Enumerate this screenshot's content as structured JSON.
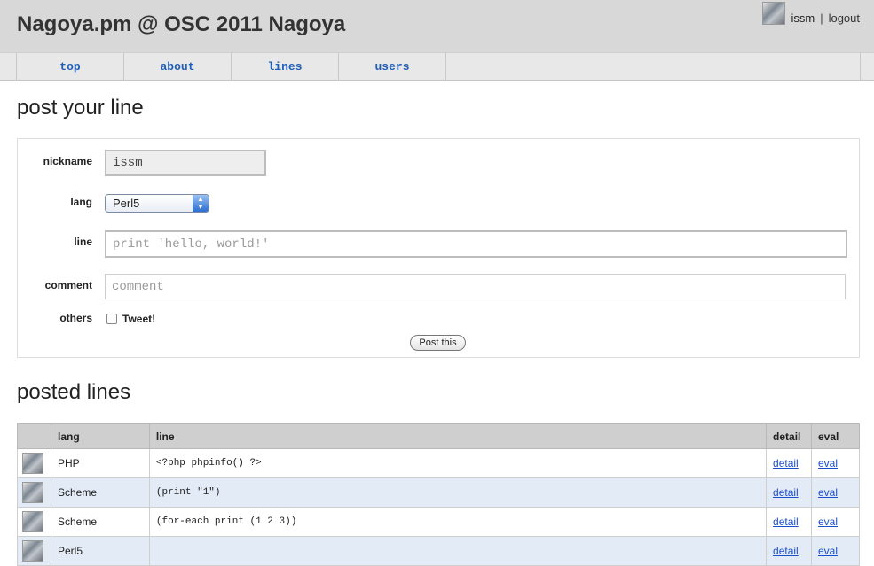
{
  "header": {
    "title": "Nagoya.pm @ OSC 2011 Nagoya",
    "username": "issm",
    "separator": "|",
    "logout": "logout"
  },
  "nav": {
    "tabs": [
      {
        "label": "top"
      },
      {
        "label": "about"
      },
      {
        "label": "lines"
      },
      {
        "label": "users"
      }
    ]
  },
  "form": {
    "heading": "post your line",
    "nickname_label": "nickname",
    "nickname_value": "issm",
    "lang_label": "lang",
    "lang_value": "Perl5",
    "line_label": "line",
    "line_placeholder": "print 'hello, world!'",
    "comment_label": "comment",
    "comment_placeholder": "comment",
    "others_label": "others",
    "tweet_label": "Tweet!",
    "submit_label": "Post this"
  },
  "posted": {
    "heading": "posted lines",
    "columns": [
      "",
      "lang",
      "line",
      "detail",
      "eval"
    ],
    "rows": [
      {
        "lang": "PHP",
        "line": "<?php phpinfo() ?>",
        "detail": "detail",
        "eval": "eval"
      },
      {
        "lang": "Scheme",
        "line": "(print \"1\")",
        "detail": "detail",
        "eval": "eval"
      },
      {
        "lang": "Scheme",
        "line": "(for-each print (1 2 3))",
        "detail": "detail",
        "eval": "eval"
      },
      {
        "lang": "Perl5",
        "line": "",
        "detail": "detail",
        "eval": "eval"
      }
    ]
  }
}
